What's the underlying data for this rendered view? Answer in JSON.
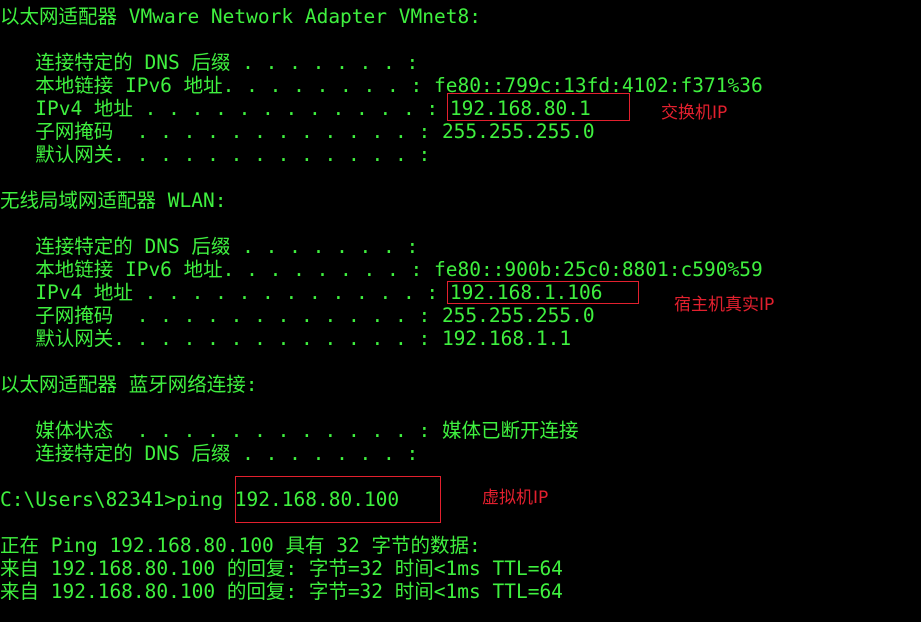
{
  "terminal": {
    "lines": [
      "以太网适配器 VMware Network Adapter VMnet8:",
      "",
      "   连接特定的 DNS 后缀 . . . . . . . :",
      "   本地链接 IPv6 地址. . . . . . . . : fe80::799c:13fd:4102:f371%36",
      "   IPv4 地址 . . . . . . . . . . . . : 192.168.80.1",
      "   子网掩码  . . . . . . . . . . . . : 255.255.255.0",
      "   默认网关. . . . . . . . . . . . . :",
      "",
      "无线局域网适配器 WLAN:",
      "",
      "   连接特定的 DNS 后缀 . . . . . . . :",
      "   本地链接 IPv6 地址. . . . . . . . : fe80::900b:25c0:8801:c590%59",
      "   IPv4 地址 . . . . . . . . . . . . : 192.168.1.106",
      "   子网掩码  . . . . . . . . . . . . : 255.255.255.0",
      "   默认网关. . . . . . . . . . . . . : 192.168.1.1",
      "",
      "以太网适配器 蓝牙网络连接:",
      "",
      "   媒体状态  . . . . . . . . . . . . : 媒体已断开连接",
      "   连接特定的 DNS 后缀 . . . . . . . :",
      "",
      "C:\\Users\\82341>ping 192.168.80.100",
      "",
      "正在 Ping 192.168.80.100 具有 32 字节的数据:",
      "来自 192.168.80.100 的回复: 字节=32 时间<1ms TTL=64",
      "来自 192.168.80.100 的回复: 字节=32 时间<1ms TTL=64"
    ]
  },
  "annotations": {
    "switch_ip_label": "交换机IP",
    "host_real_ip_label": "宿主机真实IP",
    "vm_ip_label": "虚拟机IP"
  },
  "colors": {
    "background": "#000000",
    "terminal_text": "#3ff03f",
    "annotation": "#e2202e"
  }
}
